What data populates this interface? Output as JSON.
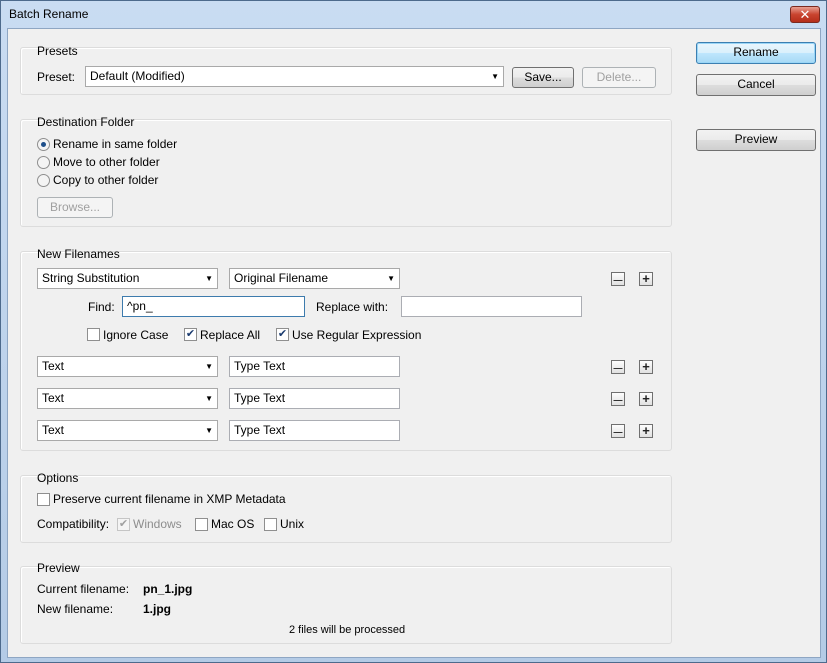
{
  "window": {
    "title": "Batch Rename",
    "close_label": "✕"
  },
  "side_buttons": {
    "rename": "Rename",
    "cancel": "Cancel",
    "preview": "Preview"
  },
  "presets": {
    "group_title": "Presets",
    "preset_label": "Preset:",
    "preset_value": "Default (Modified)",
    "save_label": "Save...",
    "delete_label": "Delete..."
  },
  "destination": {
    "group_title": "Destination Folder",
    "options": [
      "Rename in same folder",
      "Move to other folder",
      "Copy to other folder"
    ],
    "selected": 0,
    "browse_label": "Browse..."
  },
  "new_filenames": {
    "group_title": "New Filenames",
    "rows": [
      {
        "type": "String Substitution",
        "value": "Original Filename"
      },
      {
        "type": "Text",
        "value": "Type Text"
      },
      {
        "type": "Text",
        "value": "Type Text"
      },
      {
        "type": "Text",
        "value": "Type Text"
      }
    ],
    "find_label": "Find:",
    "find_value": "^pn_",
    "replace_label": "Replace with:",
    "replace_value": "",
    "ignore_case": {
      "label": "Ignore Case",
      "checked": false
    },
    "replace_all": {
      "label": "Replace All",
      "checked": true
    },
    "use_regex": {
      "label": "Use Regular Expression",
      "checked": true
    },
    "minus_glyph": "—",
    "plus_glyph": "+"
  },
  "options": {
    "group_title": "Options",
    "preserve": {
      "label": "Preserve current filename in XMP Metadata",
      "checked": false
    },
    "compat_label": "Compatibility:",
    "windows": {
      "label": "Windows",
      "checked": true,
      "disabled": true
    },
    "mac": {
      "label": "Mac OS",
      "checked": false
    },
    "unix": {
      "label": "Unix",
      "checked": false
    }
  },
  "preview": {
    "group_title": "Preview",
    "current_label": "Current filename:",
    "current_value": "pn_1.jpg",
    "new_label": "New filename:",
    "new_value": "1.jpg",
    "status": "2 files will be processed"
  }
}
